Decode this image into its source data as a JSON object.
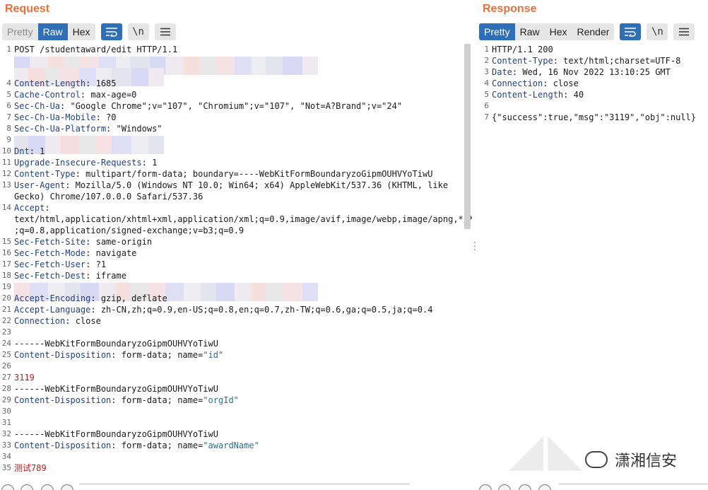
{
  "request": {
    "title": "Request",
    "tabs": [
      {
        "label": "Pretty",
        "state": "disabled"
      },
      {
        "label": "Raw",
        "state": "active"
      },
      {
        "label": "Hex",
        "state": "normal"
      }
    ],
    "newline_label": "\\n",
    "lines": [
      {
        "n": "1",
        "parts": [
          {
            "t": "POST /studentaward/edit HTTP/1.1"
          }
        ]
      },
      {
        "n": "",
        "redacted": true
      },
      {
        "n": "",
        "redacted": true
      },
      {
        "n": "4",
        "parts": [
          {
            "t": "Content-Length",
            "c": "key"
          },
          {
            "t": ": 1685"
          }
        ]
      },
      {
        "n": "5",
        "parts": [
          {
            "t": "Cache-Control",
            "c": "key"
          },
          {
            "t": ": max-age=0"
          }
        ]
      },
      {
        "n": "6",
        "parts": [
          {
            "t": "Sec-Ch-Ua",
            "c": "key"
          },
          {
            "t": ": \"Google Chrome\";v=\"107\", \"Chromium\";v=\"107\", \"Not=A?Brand\";v=\"24\""
          }
        ]
      },
      {
        "n": "7",
        "parts": [
          {
            "t": "Sec-Ch-Ua-Mobile",
            "c": "key"
          },
          {
            "t": ": ?0"
          }
        ]
      },
      {
        "n": "8",
        "parts": [
          {
            "t": "Sec-Ch-Ua-Platform",
            "c": "key"
          },
          {
            "t": ": \"Windows\""
          }
        ]
      },
      {
        "n": "9",
        "redacted": true
      },
      {
        "n": "10",
        "parts": [
          {
            "t": "Dnt",
            "c": "key"
          },
          {
            "t": ": 1"
          }
        ]
      },
      {
        "n": "11",
        "parts": [
          {
            "t": "Upgrade-Insecure-Requests",
            "c": "key"
          },
          {
            "t": ": 1"
          }
        ]
      },
      {
        "n": "12",
        "parts": [
          {
            "t": "Content-Type",
            "c": "key"
          },
          {
            "t": ": multipart/form-data; boundary=----WebKitFormBoundaryzoGipmOUHVYoTiwU"
          }
        ]
      },
      {
        "n": "13",
        "parts": [
          {
            "t": "User-Agent",
            "c": "key"
          },
          {
            "t": ": Mozilla/5.0 (Windows NT 10.0; Win64; x64) AppleWebKit/537.36 (KHTML, like"
          }
        ]
      },
      {
        "n": "",
        "parts": [
          {
            "t": "Gecko) Chrome/107.0.0.0 Safari/537.36"
          }
        ]
      },
      {
        "n": "14",
        "parts": [
          {
            "t": "Accept",
            "c": "key"
          },
          {
            "t": ":"
          }
        ]
      },
      {
        "n": "",
        "parts": [
          {
            "t": "text/html,application/xhtml+xml,application/xml;q=0.9,image/avif,image/webp,image/apng,*/*"
          }
        ]
      },
      {
        "n": "",
        "parts": [
          {
            "t": ";q=0.8,application/signed-exchange;v=b3;q=0.9"
          }
        ]
      },
      {
        "n": "15",
        "parts": [
          {
            "t": "Sec-Fetch-Site",
            "c": "key"
          },
          {
            "t": ": same-origin"
          }
        ]
      },
      {
        "n": "16",
        "parts": [
          {
            "t": "Sec-Fetch-Mode",
            "c": "key"
          },
          {
            "t": ": navigate"
          }
        ]
      },
      {
        "n": "17",
        "parts": [
          {
            "t": "Sec-Fetch-User",
            "c": "key"
          },
          {
            "t": ": ?1"
          }
        ]
      },
      {
        "n": "18",
        "parts": [
          {
            "t": "Sec-Fetch-Dest",
            "c": "key"
          },
          {
            "t": ": iframe"
          }
        ]
      },
      {
        "n": "19",
        "redacted": true
      },
      {
        "n": "20",
        "parts": [
          {
            "t": "Accept-Encoding",
            "c": "key"
          },
          {
            "t": ": gzip, deflate"
          }
        ]
      },
      {
        "n": "21",
        "parts": [
          {
            "t": "Accept-Language",
            "c": "key"
          },
          {
            "t": ": zh-CN,zh;q=0.9,en-US;q=0.8,en;q=0.7,zh-TW;q=0.6,ga;q=0.5,ja;q=0.4"
          }
        ]
      },
      {
        "n": "22",
        "parts": [
          {
            "t": "Connection",
            "c": "key"
          },
          {
            "t": ": close"
          }
        ]
      },
      {
        "n": "23",
        "parts": []
      },
      {
        "n": "24",
        "parts": [
          {
            "t": "------WebKitFormBoundaryzoGipmOUHVYoTiwU"
          }
        ]
      },
      {
        "n": "25",
        "parts": [
          {
            "t": "Content-Disposition",
            "c": "key"
          },
          {
            "t": ": form-data; name="
          },
          {
            "t": "\"id\"",
            "c": "str"
          }
        ]
      },
      {
        "n": "26",
        "parts": []
      },
      {
        "n": "27",
        "parts": [
          {
            "t": "3119",
            "c": "red"
          }
        ]
      },
      {
        "n": "28",
        "parts": [
          {
            "t": "------WebKitFormBoundaryzoGipmOUHVYoTiwU"
          }
        ]
      },
      {
        "n": "29",
        "parts": [
          {
            "t": "Content-Disposition",
            "c": "key"
          },
          {
            "t": ": form-data; name="
          },
          {
            "t": "\"orgId\"",
            "c": "str"
          }
        ]
      },
      {
        "n": "30",
        "parts": []
      },
      {
        "n": "31",
        "parts": []
      },
      {
        "n": "32",
        "parts": [
          {
            "t": "------WebKitFormBoundaryzoGipmOUHVYoTiwU"
          }
        ]
      },
      {
        "n": "33",
        "parts": [
          {
            "t": "Content-Disposition",
            "c": "key"
          },
          {
            "t": ": form-data; name="
          },
          {
            "t": "\"awardName\"",
            "c": "str"
          }
        ]
      },
      {
        "n": "34",
        "parts": []
      },
      {
        "n": "35",
        "parts": [
          {
            "t": "测试789",
            "c": "red"
          }
        ]
      }
    ]
  },
  "response": {
    "title": "Response",
    "tabs": [
      {
        "label": "Pretty",
        "state": "active"
      },
      {
        "label": "Raw",
        "state": "normal"
      },
      {
        "label": "Hex",
        "state": "normal"
      },
      {
        "label": "Render",
        "state": "normal"
      }
    ],
    "newline_label": "\\n",
    "lines": [
      {
        "n": "1",
        "parts": [
          {
            "t": "HTTP/1.1 200"
          }
        ]
      },
      {
        "n": "2",
        "parts": [
          {
            "t": "Content-Type",
            "c": "key"
          },
          {
            "t": ": text/html;charset=UTF-8"
          }
        ]
      },
      {
        "n": "3",
        "parts": [
          {
            "t": "Date",
            "c": "key"
          },
          {
            "t": ": Wed, 16 Nov 2022 13:10:25 GMT"
          }
        ]
      },
      {
        "n": "4",
        "parts": [
          {
            "t": "Connection",
            "c": "key"
          },
          {
            "t": ": close"
          }
        ]
      },
      {
        "n": "5",
        "parts": [
          {
            "t": "Content-Length",
            "c": "key"
          },
          {
            "t": ": 40"
          }
        ]
      },
      {
        "n": "6",
        "parts": []
      },
      {
        "n": "7",
        "parts": [
          {
            "t": "{\"success\":true,\"msg\":\"3119\",\"obj\":null}"
          }
        ]
      }
    ]
  },
  "watermark": {
    "text": "潇湘信安"
  },
  "colors": {
    "accent": "#e8703a",
    "active_tab": "#2f6fb7",
    "header_key": "#1f3f8f"
  }
}
